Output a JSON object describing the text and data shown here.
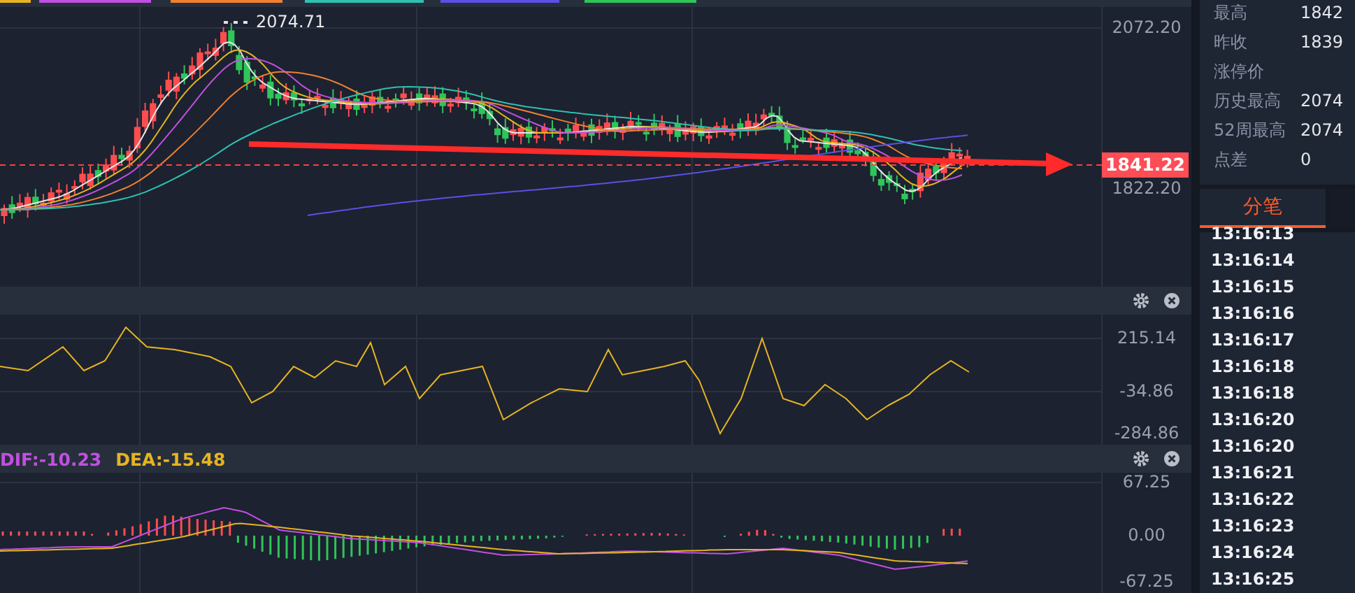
{
  "main_chart": {
    "peak_label": "2074.71",
    "axis_labels": [
      "2072.20",
      "1822.20"
    ],
    "last_price": "1841.22"
  },
  "oscillator": {
    "axis_labels": [
      "215.14",
      "-34.86",
      "-284.86"
    ]
  },
  "macd": {
    "dif": "DIF:-10.23",
    "dea": "DEA:-15.48",
    "axis_labels": [
      "67.25",
      "0.00",
      "-67.25"
    ]
  },
  "quote": [
    {
      "label": "最高",
      "value": "1842"
    },
    {
      "label": "昨收",
      "value": "1839"
    },
    {
      "label": "涨停价"
    },
    {
      "label": "历史最高",
      "value": "2074"
    },
    {
      "label": "52周最高",
      "value": "2074"
    },
    {
      "label": "点差",
      "value": "0"
    }
  ],
  "tabs": [
    {
      "label": "分笔",
      "selected": true
    },
    {
      "selected": false
    }
  ],
  "ticks": [
    "13:16:13",
    "13:16:14",
    "13:16:15",
    "13:16:16",
    "13:16:17",
    "13:16:18",
    "13:16:18",
    "13:16:20",
    "13:16:20",
    "13:16:21",
    "13:16:22",
    "13:16:23",
    "13:16:24",
    "13:16:25"
  ]
}
